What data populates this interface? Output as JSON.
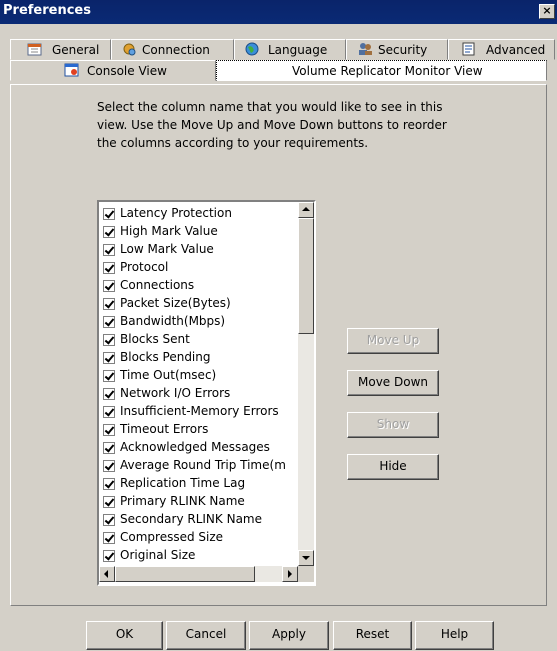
{
  "window": {
    "title": "Preferences",
    "close_label": "×"
  },
  "tabs_row1": [
    {
      "label": "General",
      "icon": "calendar-icon"
    },
    {
      "label": "Connection",
      "icon": "connection-icon"
    },
    {
      "label": "Language",
      "icon": "globe-icon"
    },
    {
      "label": "Security",
      "icon": "users-icon"
    },
    {
      "label": "Advanced",
      "icon": "advanced-icon"
    }
  ],
  "tabs_row2": [
    {
      "label": "Console View",
      "icon": "console-icon"
    },
    {
      "label": "Volume Replicator Monitor View"
    }
  ],
  "instructions": "Select the column name that you would like to see in this view. Use the Move Up and Move Down buttons to reorder the columns according to your requirements.",
  "columns": [
    {
      "label": "Latency Protection",
      "checked": true
    },
    {
      "label": "High Mark Value",
      "checked": true
    },
    {
      "label": "Low Mark Value",
      "checked": true
    },
    {
      "label": "Protocol",
      "checked": true
    },
    {
      "label": "Connections",
      "checked": true
    },
    {
      "label": "Packet Size(Bytes)",
      "checked": true
    },
    {
      "label": "Bandwidth(Mbps)",
      "checked": true
    },
    {
      "label": "Blocks Sent",
      "checked": true
    },
    {
      "label": "Blocks Pending",
      "checked": true
    },
    {
      "label": "Time Out(msec)",
      "checked": true
    },
    {
      "label": "Network I/O Errors",
      "checked": true
    },
    {
      "label": "Insufficient-Memory Errors",
      "checked": true
    },
    {
      "label": "Timeout Errors",
      "checked": true
    },
    {
      "label": "Acknowledged Messages",
      "checked": true
    },
    {
      "label": "Average Round Trip Time(m",
      "checked": true
    },
    {
      "label": "Replication Time Lag",
      "checked": true
    },
    {
      "label": "Primary RLINK Name",
      "checked": true
    },
    {
      "label": "Secondary RLINK Name",
      "checked": true
    },
    {
      "label": "Compressed Size",
      "checked": true
    },
    {
      "label": "Original Size",
      "checked": true
    }
  ],
  "side_buttons": {
    "move_up": {
      "label": "Move Up",
      "enabled": false
    },
    "move_down": {
      "label": "Move Down",
      "enabled": true
    },
    "show": {
      "label": "Show",
      "enabled": false
    },
    "hide": {
      "label": "Hide",
      "enabled": true
    }
  },
  "footer_buttons": {
    "ok": "OK",
    "cancel": "Cancel",
    "apply": "Apply",
    "reset": "Reset",
    "help": "Help"
  }
}
